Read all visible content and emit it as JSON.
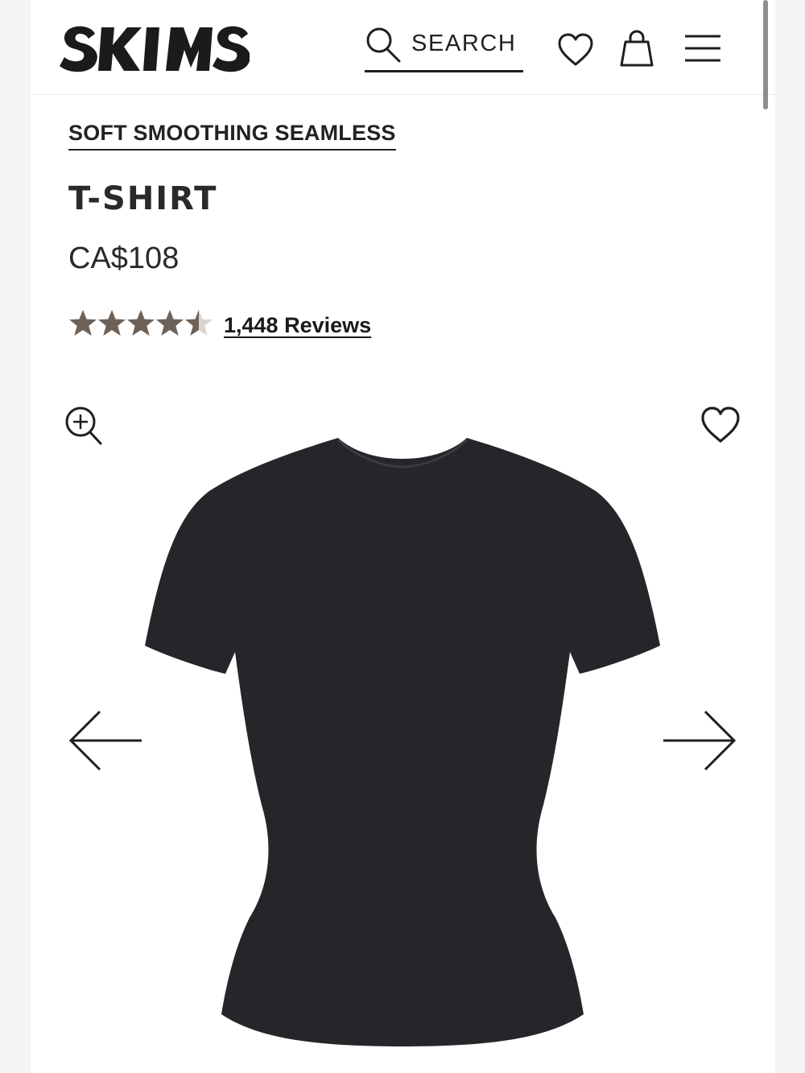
{
  "header": {
    "brand": "SKIMS",
    "search_label": "SEARCH"
  },
  "product": {
    "collection": "SOFT SMOOTHING SEAMLESS",
    "name": "T-SHIRT",
    "price": "CA$108",
    "rating": 4.5,
    "rating_max": 5,
    "reviews_label": "1,448 Reviews",
    "color_hex": "#26262a"
  },
  "colors": {
    "star": "#6e6157",
    "text": "#1f1f1f"
  }
}
